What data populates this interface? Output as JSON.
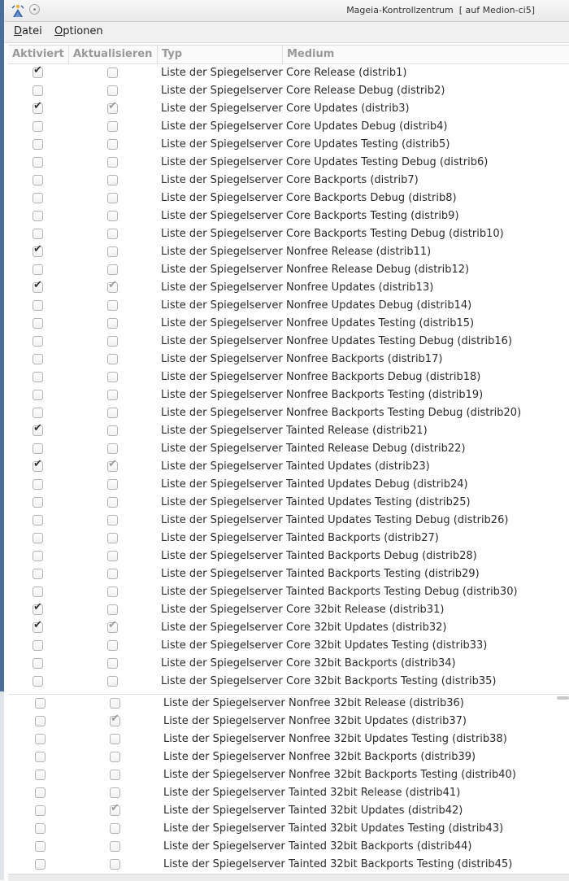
{
  "window": {
    "title": "Mageia-Kontrollzentrum  [ auf Medion-ci5]",
    "icon": "mageia-logo-icon"
  },
  "menu": [
    {
      "label": "Datei"
    },
    {
      "label": "Optionen"
    }
  ],
  "columns": [
    "Aktiviert",
    "Aktualisieren",
    "Typ",
    "Medium"
  ],
  "rows": [
    {
      "enabled": true,
      "update": false,
      "type": "Liste der Spiegelserver",
      "medium": "Core Release (distrib1)"
    },
    {
      "enabled": false,
      "update": false,
      "type": "Liste der Spiegelserver",
      "medium": "Core Release Debug (distrib2)"
    },
    {
      "enabled": true,
      "update": true,
      "type": "Liste der Spiegelserver",
      "medium": "Core Updates (distrib3)"
    },
    {
      "enabled": false,
      "update": false,
      "type": "Liste der Spiegelserver",
      "medium": "Core Updates Debug (distrib4)"
    },
    {
      "enabled": false,
      "update": false,
      "type": "Liste der Spiegelserver",
      "medium": "Core Updates Testing (distrib5)"
    },
    {
      "enabled": false,
      "update": false,
      "type": "Liste der Spiegelserver",
      "medium": "Core Updates Testing Debug (distrib6)"
    },
    {
      "enabled": false,
      "update": false,
      "type": "Liste der Spiegelserver",
      "medium": "Core Backports (distrib7)"
    },
    {
      "enabled": false,
      "update": false,
      "type": "Liste der Spiegelserver",
      "medium": "Core Backports Debug (distrib8)"
    },
    {
      "enabled": false,
      "update": false,
      "type": "Liste der Spiegelserver",
      "medium": "Core Backports Testing (distrib9)"
    },
    {
      "enabled": false,
      "update": false,
      "type": "Liste der Spiegelserver",
      "medium": "Core Backports Testing Debug (distrib10)"
    },
    {
      "enabled": true,
      "update": false,
      "type": "Liste der Spiegelserver",
      "medium": "Nonfree Release (distrib11)"
    },
    {
      "enabled": false,
      "update": false,
      "type": "Liste der Spiegelserver",
      "medium": "Nonfree Release Debug (distrib12)"
    },
    {
      "enabled": true,
      "update": true,
      "type": "Liste der Spiegelserver",
      "medium": "Nonfree Updates (distrib13)"
    },
    {
      "enabled": false,
      "update": false,
      "type": "Liste der Spiegelserver",
      "medium": "Nonfree Updates Debug (distrib14)"
    },
    {
      "enabled": false,
      "update": false,
      "type": "Liste der Spiegelserver",
      "medium": "Nonfree Updates Testing (distrib15)"
    },
    {
      "enabled": false,
      "update": false,
      "type": "Liste der Spiegelserver",
      "medium": "Nonfree Updates Testing Debug (distrib16)"
    },
    {
      "enabled": false,
      "update": false,
      "type": "Liste der Spiegelserver",
      "medium": "Nonfree Backports (distrib17)"
    },
    {
      "enabled": false,
      "update": false,
      "type": "Liste der Spiegelserver",
      "medium": "Nonfree Backports Debug (distrib18)"
    },
    {
      "enabled": false,
      "update": false,
      "type": "Liste der Spiegelserver",
      "medium": "Nonfree Backports Testing (distrib19)"
    },
    {
      "enabled": false,
      "update": false,
      "type": "Liste der Spiegelserver",
      "medium": "Nonfree Backports Testing Debug (distrib20)"
    },
    {
      "enabled": true,
      "update": false,
      "type": "Liste der Spiegelserver",
      "medium": "Tainted Release (distrib21)"
    },
    {
      "enabled": false,
      "update": false,
      "type": "Liste der Spiegelserver",
      "medium": "Tainted Release Debug (distrib22)"
    },
    {
      "enabled": true,
      "update": true,
      "type": "Liste der Spiegelserver",
      "medium": "Tainted Updates (distrib23)"
    },
    {
      "enabled": false,
      "update": false,
      "type": "Liste der Spiegelserver",
      "medium": "Tainted Updates Debug (distrib24)"
    },
    {
      "enabled": false,
      "update": false,
      "type": "Liste der Spiegelserver",
      "medium": "Tainted Updates Testing (distrib25)"
    },
    {
      "enabled": false,
      "update": false,
      "type": "Liste der Spiegelserver",
      "medium": "Tainted Updates Testing Debug (distrib26)"
    },
    {
      "enabled": false,
      "update": false,
      "type": "Liste der Spiegelserver",
      "medium": "Tainted Backports (distrib27)"
    },
    {
      "enabled": false,
      "update": false,
      "type": "Liste der Spiegelserver",
      "medium": "Tainted Backports Debug (distrib28)"
    },
    {
      "enabled": false,
      "update": false,
      "type": "Liste der Spiegelserver",
      "medium": "Tainted Backports Testing (distrib29)"
    },
    {
      "enabled": false,
      "update": false,
      "type": "Liste der Spiegelserver",
      "medium": "Tainted Backports Testing Debug (distrib30)"
    },
    {
      "enabled": true,
      "update": false,
      "type": "Liste der Spiegelserver",
      "medium": "Core 32bit Release (distrib31)"
    },
    {
      "enabled": true,
      "update": true,
      "type": "Liste der Spiegelserver",
      "medium": "Core 32bit Updates (distrib32)"
    },
    {
      "enabled": false,
      "update": false,
      "type": "Liste der Spiegelserver",
      "medium": "Core 32bit Updates Testing (distrib33)"
    },
    {
      "enabled": false,
      "update": false,
      "type": "Liste der Spiegelserver",
      "medium": "Core 32bit Backports (distrib34)"
    },
    {
      "enabled": false,
      "update": false,
      "type": "Liste der Spiegelserver",
      "medium": "Core 32bit Backports Testing (distrib35)"
    },
    {
      "enabled": false,
      "update": false,
      "type": "Liste der Spiegelserver",
      "medium": "Nonfree 32bit Release (distrib36)"
    },
    {
      "enabled": false,
      "update": true,
      "type": "Liste der Spiegelserver",
      "medium": "Nonfree 32bit Updates (distrib37)"
    },
    {
      "enabled": false,
      "update": false,
      "type": "Liste der Spiegelserver",
      "medium": "Nonfree 32bit Updates Testing (distrib38)"
    },
    {
      "enabled": false,
      "update": false,
      "type": "Liste der Spiegelserver",
      "medium": "Nonfree 32bit Backports (distrib39)"
    },
    {
      "enabled": false,
      "update": false,
      "type": "Liste der Spiegelserver",
      "medium": "Nonfree 32bit Backports Testing (distrib40)"
    },
    {
      "enabled": false,
      "update": false,
      "type": "Liste der Spiegelserver",
      "medium": "Tainted 32bit Release (distrib41)"
    },
    {
      "enabled": false,
      "update": true,
      "type": "Liste der Spiegelserver",
      "medium": "Tainted 32bit Updates (distrib42)"
    },
    {
      "enabled": false,
      "update": false,
      "type": "Liste der Spiegelserver",
      "medium": "Tainted 32bit Updates Testing (distrib43)"
    },
    {
      "enabled": false,
      "update": false,
      "type": "Liste der Spiegelserver",
      "medium": "Tainted 32bit Backports (distrib44)"
    },
    {
      "enabled": false,
      "update": false,
      "type": "Liste der Spiegelserver",
      "medium": "Tainted 32bit Backports Testing (distrib45)"
    }
  ]
}
